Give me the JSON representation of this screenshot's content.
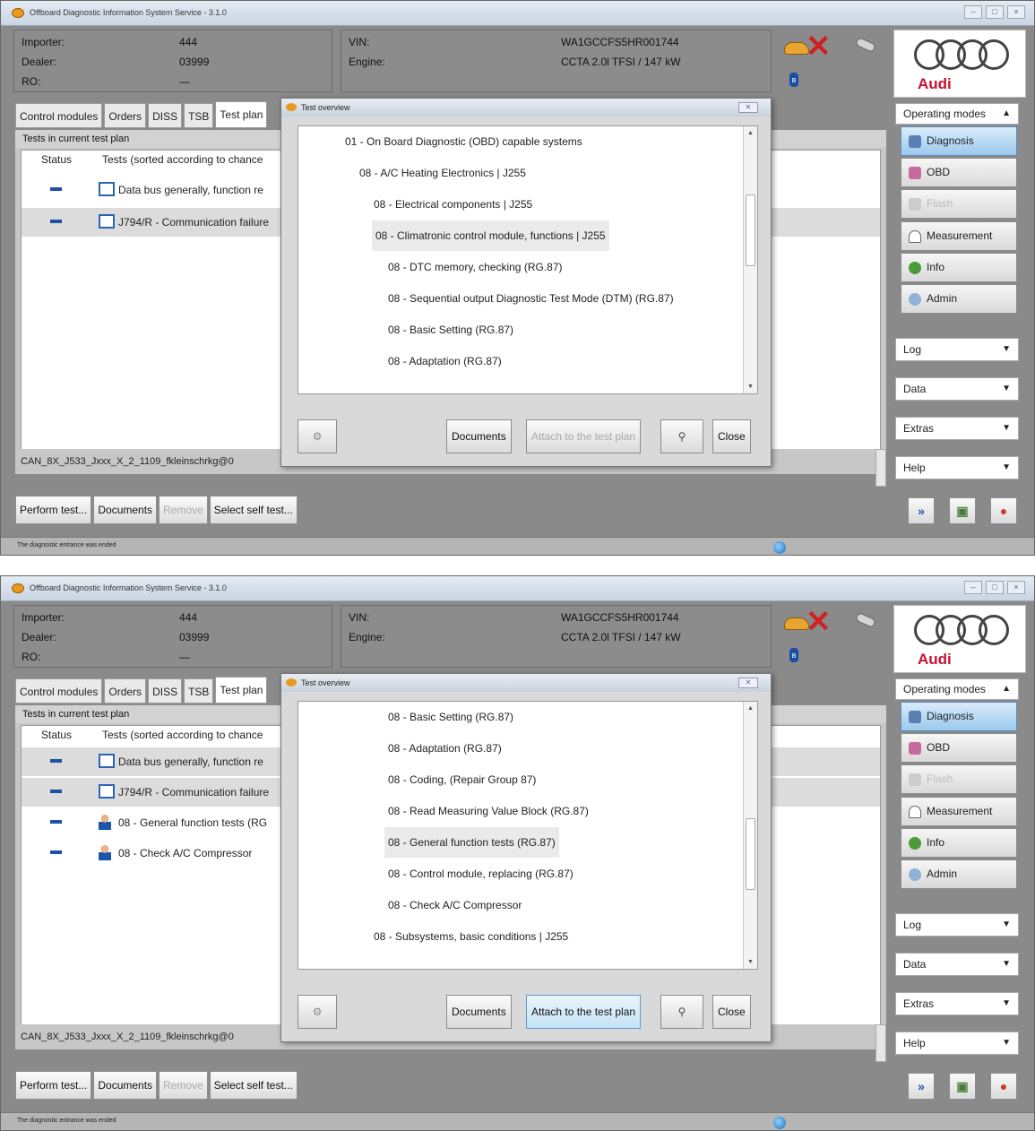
{
  "screens": [
    {
      "window_title": "Offboard Diagnostic Information System Service - 3.1.0",
      "win_buttons": [
        "–",
        "□",
        "×"
      ],
      "info_left": [
        {
          "label": "Importer:",
          "value": "444"
        },
        {
          "label": "Dealer:",
          "value": "03999"
        },
        {
          "label": "RO:",
          "value": "—"
        }
      ],
      "info_mid": [
        {
          "label": "VIN:",
          "value": "WA1GCCFS5HR001744"
        },
        {
          "label": "Engine:",
          "value": "CCTA 2.0l TFSI / 147 kW"
        }
      ],
      "brand": "Audi",
      "tabs": [
        "Control modules",
        "Orders",
        "DISS",
        "TSB",
        "Test plan"
      ],
      "panel_heading": "Tests in current test plan",
      "columns": {
        "status": "Status",
        "tests": "Tests (sorted according to chance"
      },
      "rows": [
        {
          "text": "Data bus generally, function re",
          "icon": "doc-icon"
        },
        {
          "text": "J794/R - Communication failure",
          "icon": "doc-icon"
        }
      ],
      "path": "CAN_8X_J533_Jxxx_X_2_1109_fkleinschrkg@0",
      "buttons": {
        "perform": "Perform test...",
        "documents": "Documents",
        "remove": "Remove",
        "select": "Select self test..."
      },
      "status_text": "The diagnostic entrance was ended",
      "sidebar": {
        "header": "Operating modes",
        "modes": [
          "Diagnosis",
          "OBD",
          "Flash",
          "Measurement",
          "Info",
          "Admin"
        ],
        "sections": [
          "Log",
          "Data",
          "Extras",
          "Help"
        ]
      },
      "dialog": {
        "title": "Test overview",
        "items": [
          {
            "text": "01 - On Board Diagnostic (OBD) capable systems"
          },
          {
            "text": "08 - A/C Heating Electronics | J255"
          },
          {
            "text": "08 - Electrical components | J255"
          },
          {
            "text": "08 - Climatronic control module, functions | J255"
          },
          {
            "text": "08 - DTC memory, checking (RG.87)"
          },
          {
            "text": "08 - Sequential output Diagnostic Test Mode (DTM) (RG.87)"
          },
          {
            "text": "08 - Basic Setting (RG.87)"
          },
          {
            "text": "08 - Adaptation (RG.87)"
          }
        ],
        "btn_documents": "Documents",
        "btn_attach": "Attach to the test plan",
        "btn_close": "Close"
      }
    },
    {
      "window_title": "Offboard Diagnostic Information System Service - 3.1.0",
      "win_buttons": [
        "–",
        "□",
        "×"
      ],
      "info_left": [
        {
          "label": "Importer:",
          "value": "444"
        },
        {
          "label": "Dealer:",
          "value": "03999"
        },
        {
          "label": "RO:",
          "value": "—"
        }
      ],
      "info_mid": [
        {
          "label": "VIN:",
          "value": "WA1GCCFS5HR001744"
        },
        {
          "label": "Engine:",
          "value": "CCTA 2.0l TFSI / 147 kW"
        }
      ],
      "brand": "Audi",
      "tabs": [
        "Control modules",
        "Orders",
        "DISS",
        "TSB",
        "Test plan"
      ],
      "panel_heading": "Tests in current test plan",
      "columns": {
        "status": "Status",
        "tests": "Tests (sorted according to chance"
      },
      "rows": [
        {
          "text": "Data bus generally, function re",
          "icon": "doc-icon"
        },
        {
          "text": "J794/R - Communication failure",
          "icon": "doc-icon"
        },
        {
          "text": "08 - General function tests (RG",
          "icon": "person-icon"
        },
        {
          "text": "08 - Check A/C Compressor",
          "icon": "person-icon"
        }
      ],
      "path": "CAN_8X_J533_Jxxx_X_2_1109_fkleinschrkg@0",
      "buttons": {
        "perform": "Perform test...",
        "documents": "Documents",
        "remove": "Remove",
        "select": "Select self test..."
      },
      "status_text": "The diagnostic entrance was ended",
      "sidebar": {
        "header": "Operating modes",
        "modes": [
          "Diagnosis",
          "OBD",
          "Flash",
          "Measurement",
          "Info",
          "Admin"
        ],
        "sections": [
          "Log",
          "Data",
          "Extras",
          "Help"
        ]
      },
      "dialog": {
        "title": "Test overview",
        "items": [
          {
            "text": "08 - Basic Setting (RG.87)"
          },
          {
            "text": "08 - Adaptation (RG.87)"
          },
          {
            "text": "08 - Coding, (Repair Group 87)"
          },
          {
            "text": "08 - Read Measuring Value Block (RG.87)"
          },
          {
            "text": "08 - General function tests (RG.87)"
          },
          {
            "text": "08 - Control module, replacing (RG.87)"
          },
          {
            "text": "08 - Check A/C Compressor"
          },
          {
            "text": "08 - Subsystems, basic conditions | J255"
          }
        ],
        "btn_documents": "Documents",
        "btn_attach": "Attach to the test plan",
        "btn_close": "Close"
      }
    }
  ]
}
